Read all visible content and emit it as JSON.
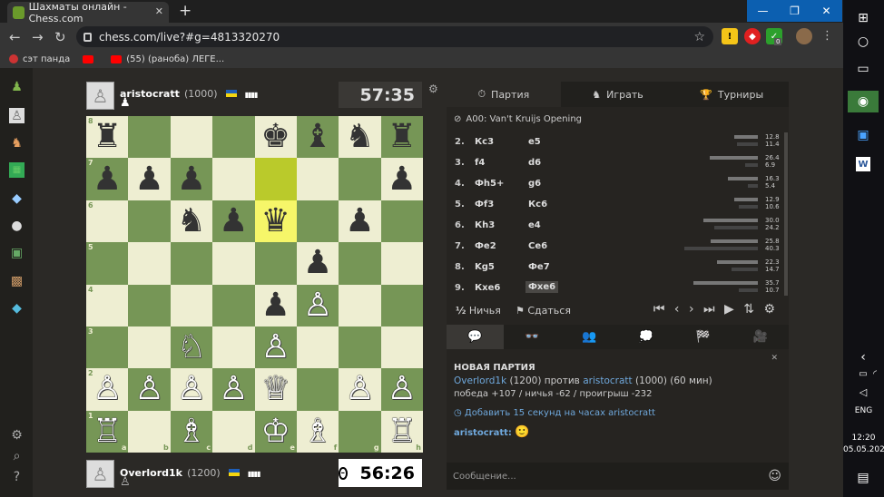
{
  "browser": {
    "tab_title": "Шахматы онлайн - Chess.com",
    "tab_close": "✕",
    "new_tab": "+",
    "url": "chess.com/live?#g=4813320270",
    "bookmarks": [
      {
        "label": "сэт панда"
      },
      {
        "label": ""
      },
      {
        "label": "(55) (раноба) ЛЕГЕ..."
      }
    ],
    "back": "←",
    "forward": "→",
    "reload": "↻",
    "star": "☆",
    "menu": "⋮",
    "window_min": "—",
    "window_max": "❐",
    "window_close": "✕",
    "ext_badge": "0"
  },
  "players": {
    "top": {
      "name": "aristocratt",
      "rating": "(1000)",
      "clock": "57:35",
      "status": "♟"
    },
    "bottom": {
      "name": "Overlord1k",
      "rating": "(1200)",
      "clock": "56:26",
      "status": "♙"
    }
  },
  "board": {
    "ranks": [
      "8",
      "7",
      "6",
      "5",
      "4",
      "3",
      "2",
      "1"
    ],
    "files": [
      "a",
      "b",
      "c",
      "d",
      "e",
      "f",
      "g",
      "h"
    ],
    "squares": [
      [
        "♜",
        "",
        "",
        "",
        "♚",
        "♝",
        "♞",
        "♜"
      ],
      [
        "♟",
        "♟",
        "♟",
        "",
        "",
        "",
        "",
        "♟"
      ],
      [
        "",
        "",
        "♞",
        "♟",
        "♛",
        "",
        "♟",
        ""
      ],
      [
        "",
        "",
        "",
        "",
        "",
        "♟",
        "",
        ""
      ],
      [
        "",
        "",
        "",
        "",
        "♟",
        "♙",
        "",
        ""
      ],
      [
        "",
        "",
        "♘",
        "",
        "♙",
        "",
        "",
        ""
      ],
      [
        "♙",
        "♙",
        "♙",
        "♙",
        "♕",
        "",
        "♙",
        "♙"
      ],
      [
        "♖",
        "",
        "♗",
        "",
        "♔",
        "♗",
        "",
        "♖"
      ]
    ],
    "colors": [
      [
        "b",
        "",
        "",
        "",
        "b",
        "b",
        "b",
        "b"
      ],
      [
        "b",
        "b",
        "b",
        "",
        "",
        "",
        "",
        "b"
      ],
      [
        "",
        "",
        "b",
        "b",
        "b",
        "",
        "b",
        ""
      ],
      [
        "",
        "",
        "",
        "",
        "",
        "b",
        "",
        ""
      ],
      [
        "",
        "",
        "",
        "",
        "b",
        "w",
        "",
        ""
      ],
      [
        "",
        "",
        "w",
        "",
        "w",
        "",
        "",
        ""
      ],
      [
        "w",
        "w",
        "w",
        "w",
        "w",
        "",
        "w",
        "w"
      ],
      [
        "w",
        "",
        "w",
        "",
        "w",
        "w",
        "",
        "w"
      ]
    ],
    "highlight": [
      [
        1,
        4
      ],
      [
        2,
        4
      ]
    ]
  },
  "panel": {
    "tabs": [
      {
        "icon": "⏱",
        "label": "Партия"
      },
      {
        "icon": "♞",
        "label": "Играть"
      },
      {
        "icon": "🏆",
        "label": "Турниры"
      }
    ],
    "opening": "A00: Van't Kruijs Opening",
    "moves": [
      {
        "n": "2.",
        "w": "Кс3",
        "b": "е5",
        "t1": "12.8",
        "t2": "11.4"
      },
      {
        "n": "3.",
        "w": "f4",
        "b": "d6",
        "t1": "26.4",
        "t2": "6.9"
      },
      {
        "n": "4.",
        "w": "Фh5+",
        "b": "g6",
        "t1": "16.3",
        "t2": "5.4"
      },
      {
        "n": "5.",
        "w": "Фf3",
        "b": "Кс6",
        "t1": "12.9",
        "t2": "10.6"
      },
      {
        "n": "6.",
        "w": "Кh3",
        "b": "е4",
        "t1": "30.0",
        "t2": "24.2"
      },
      {
        "n": "7.",
        "w": "Фе2",
        "b": "Се6",
        "t1": "25.8",
        "t2": "40.3"
      },
      {
        "n": "8.",
        "w": "Kg5",
        "b": "Фе7",
        "t1": "22.3",
        "t2": "14.7"
      },
      {
        "n": "9.",
        "w": "Кхе6",
        "b": "Фхе6",
        "t1": "35.7",
        "t2": "10.7"
      }
    ],
    "draw": "Ничья",
    "draw_icon": "½",
    "resign": "Сдаться",
    "resign_icon": "⚑",
    "nav_controls": "⏮ ‹ › ⏭ ▶ ⇅ ⚙",
    "chat_tabs": [
      "💬",
      "👓",
      "👥",
      "💭",
      "🏁",
      "🎥"
    ],
    "chat": {
      "header": "НОВАЯ ПАРТИЯ",
      "p1": "Overlord1k",
      "p1r": "(1200)",
      "vs": "против",
      "p2": "aristocratt",
      "p2r": "(1000)",
      "time": "(60 мин)",
      "stats": "победа +107 / ничья -62 / проигрыш -232",
      "add_time": "Добавить 15 секунд на часах aristocratt",
      "author": "aristocratt:",
      "emoji": "🙂",
      "placeholder": "Сообщение...",
      "close": "✕"
    }
  },
  "taskbar": {
    "lang": "ENG",
    "time": "12:20",
    "date": "05.05.2020"
  },
  "colors": {
    "board_light": "#eeeed2",
    "board_dark": "#769656",
    "link": "#6fa8dc"
  }
}
